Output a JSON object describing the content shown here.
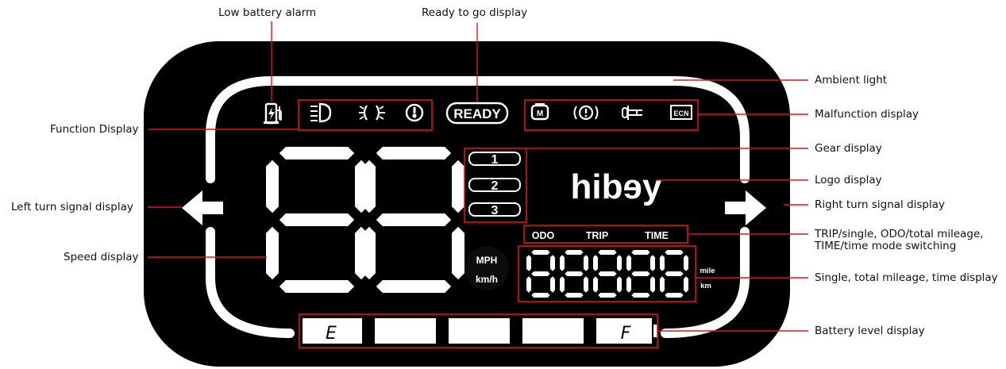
{
  "callouts": {
    "low_battery_alarm": "Low battery alarm",
    "ready_to_go_display": "Ready to go display",
    "function_display": "Function Display",
    "left_turn_signal_display": "Left turn signal display",
    "speed_display": "Speed display",
    "ambient_light": "Ambient light",
    "malfunction_display": "Malfunction display",
    "gear_display": "Gear display",
    "logo_display": "Logo display",
    "right_turn_signal_display": "Right turn signal display",
    "trip_odo_time_line1": "TRIP/single, ODO/total mileage,",
    "trip_odo_time_line2": "TIME/time mode switching",
    "mileage_time_display": "Single, total mileage, time display",
    "battery_level_display": "Battery level display"
  },
  "panel": {
    "ready_label": "READY",
    "logo_text": "hibɘy",
    "gears": [
      "1",
      "2",
      "3"
    ],
    "mode_labels": [
      "ODO",
      "TRIP",
      "TIME"
    ],
    "speed_units": [
      "MPH",
      "km/h"
    ],
    "distance_units": [
      "mile",
      "km"
    ],
    "battery_empty_label": "E",
    "battery_full_label": "F",
    "battery_segments": 5,
    "ecn_label": "ECN"
  },
  "icons": {
    "function": [
      "low-beam-headlight-icon",
      "parking-light-icon",
      "temperature-warning-icon"
    ],
    "malfunction": [
      "motor-fault-icon",
      "brake-warning-icon",
      "throttle-fault-icon",
      "ecn-icon"
    ],
    "alarm": "low-battery-icon"
  },
  "colors": {
    "panel": "#000000",
    "segments": "#ffffff",
    "callout_lines": "#e0141b"
  }
}
